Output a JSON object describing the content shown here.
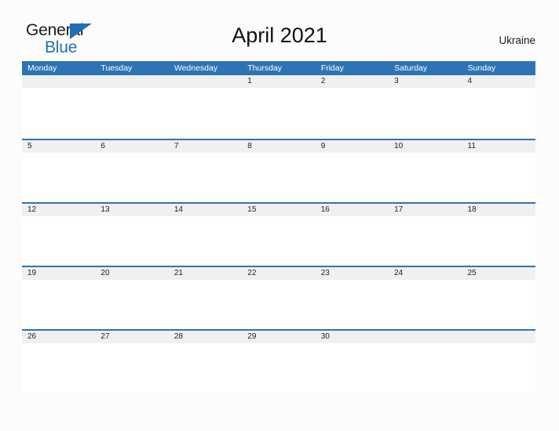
{
  "branding": {
    "logo_text_primary": "General",
    "logo_text_secondary": "Blue",
    "logo_triangle_color": "#1f6fb4"
  },
  "header": {
    "title": "April 2021",
    "country": "Ukraine"
  },
  "theme": {
    "header_blue": "#2e74b5",
    "band_gray": "#f0f0f0",
    "page_background": "#fcfcfc",
    "text_dark": "#222222",
    "text_white": "#ffffff"
  },
  "calendar": {
    "month": "April",
    "year": "2021",
    "weekday_headers": [
      "Monday",
      "Tuesday",
      "Wednesday",
      "Thursday",
      "Friday",
      "Saturday",
      "Sunday"
    ],
    "weeks": [
      [
        "",
        "",
        "",
        "1",
        "2",
        "3",
        "4"
      ],
      [
        "5",
        "6",
        "7",
        "8",
        "9",
        "10",
        "11"
      ],
      [
        "12",
        "13",
        "14",
        "15",
        "16",
        "17",
        "18"
      ],
      [
        "19",
        "20",
        "21",
        "22",
        "23",
        "24",
        "25"
      ],
      [
        "26",
        "27",
        "28",
        "29",
        "30",
        "",
        ""
      ]
    ]
  }
}
